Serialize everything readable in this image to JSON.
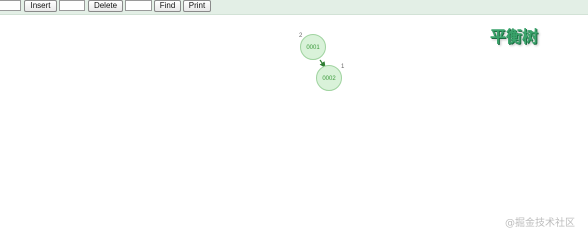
{
  "toolbar": {
    "insert_input_value": "",
    "insert_label": "Insert",
    "delete_input_value": "",
    "delete_label": "Delete",
    "find_input_value": "",
    "find_label": "Find",
    "print_label": "Print"
  },
  "title": "平衡树",
  "tree": {
    "nodes": [
      {
        "id": "root",
        "label": "0001",
        "height_label": "2"
      },
      {
        "id": "right-child",
        "label": "0002",
        "height_label": "1"
      }
    ],
    "edge_color": "#2e7d32",
    "node_fill": "#d9f2d9",
    "node_stroke": "#9fd39f",
    "title_color": "#3aa36b"
  },
  "watermark": "@掘金技术社区"
}
